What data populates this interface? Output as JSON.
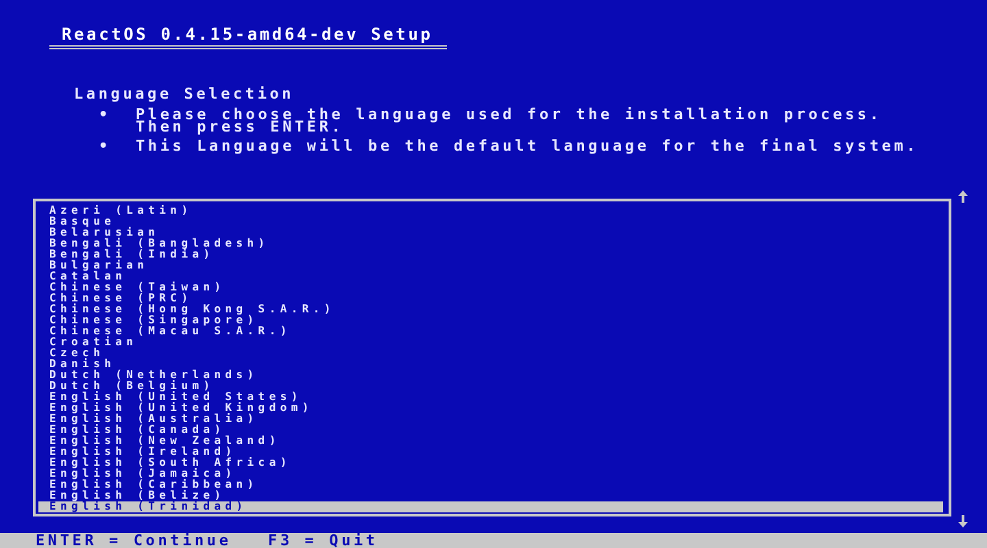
{
  "window": {
    "title": "ReactOS 0.4.15-amd64-dev Setup"
  },
  "page": {
    "heading": "Language Selection",
    "bullets": [
      {
        "mark": "•",
        "text": "Please choose the language used for the installation process.",
        "continuation": "Then press ENTER."
      },
      {
        "mark": "•",
        "text": "This Language will be the default language for the final system."
      }
    ]
  },
  "language_list": {
    "items": [
      {
        "label": "Azeri (Latin)",
        "selected": false
      },
      {
        "label": "Basque",
        "selected": false
      },
      {
        "label": "Belarusian",
        "selected": false
      },
      {
        "label": "Bengali (Bangladesh)",
        "selected": false
      },
      {
        "label": "Bengali (India)",
        "selected": false
      },
      {
        "label": "Bulgarian",
        "selected": false
      },
      {
        "label": "Catalan",
        "selected": false
      },
      {
        "label": "Chinese (Taiwan)",
        "selected": false
      },
      {
        "label": "Chinese (PRC)",
        "selected": false
      },
      {
        "label": "Chinese (Hong Kong S.A.R.)",
        "selected": false
      },
      {
        "label": "Chinese (Singapore)",
        "selected": false
      },
      {
        "label": "Chinese (Macau S.A.R.)",
        "selected": false
      },
      {
        "label": "Croatian",
        "selected": false
      },
      {
        "label": "Czech",
        "selected": false
      },
      {
        "label": "Danish",
        "selected": false
      },
      {
        "label": "Dutch (Netherlands)",
        "selected": false
      },
      {
        "label": "Dutch (Belgium)",
        "selected": false
      },
      {
        "label": "English (United States)",
        "selected": false
      },
      {
        "label": "English (United Kingdom)",
        "selected": false
      },
      {
        "label": "English (Australia)",
        "selected": false
      },
      {
        "label": "English (Canada)",
        "selected": false
      },
      {
        "label": "English (New Zealand)",
        "selected": false
      },
      {
        "label": "English (Ireland)",
        "selected": false
      },
      {
        "label": "English (South Africa)",
        "selected": false
      },
      {
        "label": "English (Jamaica)",
        "selected": false
      },
      {
        "label": "English (Caribbean)",
        "selected": false
      },
      {
        "label": "English (Belize)",
        "selected": false
      },
      {
        "label": "English (Trinidad)",
        "selected": true
      }
    ]
  },
  "status_bar": {
    "text": "ENTER = Continue   F3 = Quit"
  }
}
